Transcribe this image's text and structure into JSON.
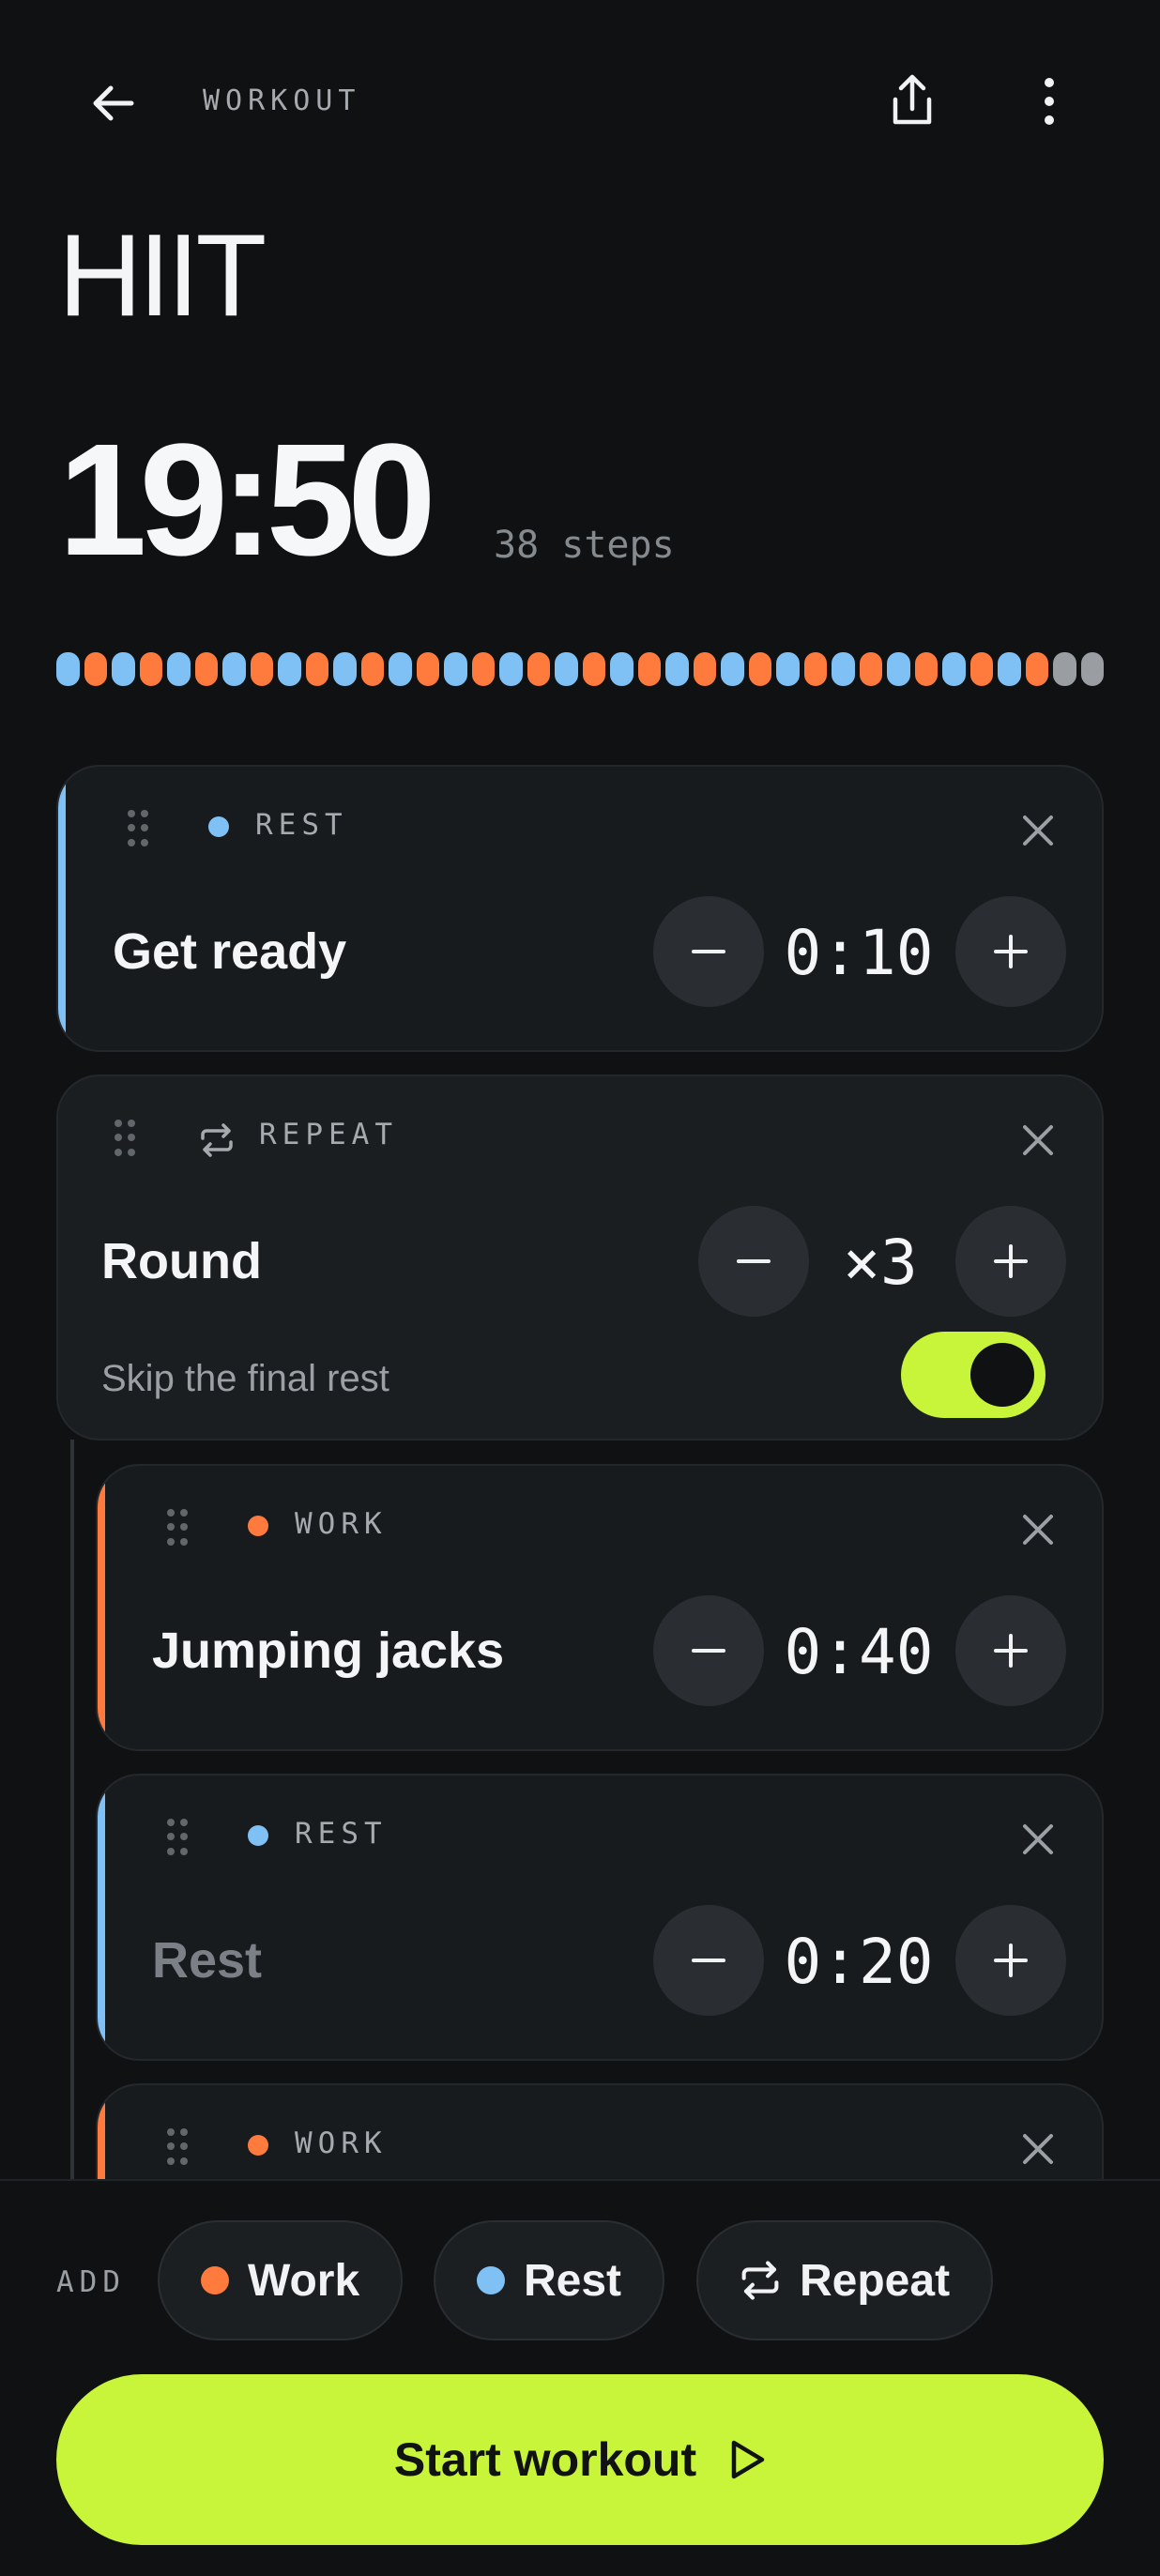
{
  "header": {
    "label": "WORKOUT"
  },
  "workout": {
    "title": "HIIT",
    "total_time": "19:50",
    "steps_label": "38 steps"
  },
  "timeline": {
    "segments": [
      "rest",
      "work",
      "rest",
      "work",
      "rest",
      "work",
      "rest",
      "work",
      "rest",
      "work",
      "rest",
      "work",
      "rest",
      "work",
      "rest",
      "work",
      "rest",
      "work",
      "rest",
      "work",
      "rest",
      "work",
      "rest",
      "work",
      "rest",
      "work",
      "rest",
      "work",
      "rest",
      "work",
      "rest",
      "work",
      "rest",
      "work",
      "rest",
      "work",
      "done",
      "done"
    ],
    "colors": {
      "rest": "#7fc1f5",
      "work": "#ff7a3d",
      "done": "#9a9da1"
    }
  },
  "steps": [
    {
      "type_label": "REST",
      "name": "Get ready",
      "duration": "0:10"
    },
    {
      "type_label": "WORK",
      "name": "Jumping jacks",
      "duration": "0:40"
    },
    {
      "type_label": "REST",
      "name": "Rest",
      "duration": "0:20"
    },
    {
      "type_label": "WORK"
    }
  ],
  "repeat": {
    "type_label": "REPEAT",
    "name": "Round",
    "count": "×3",
    "skip_label": "Skip the final rest",
    "skip_enabled": true
  },
  "add_bar": {
    "label": "ADD",
    "work": "Work",
    "rest": "Rest",
    "repeat": "Repeat"
  },
  "start_label": "Start workout",
  "colors": {
    "accent": "#c8f53a",
    "work": "#ff7a3d",
    "rest": "#7fc1f5"
  }
}
